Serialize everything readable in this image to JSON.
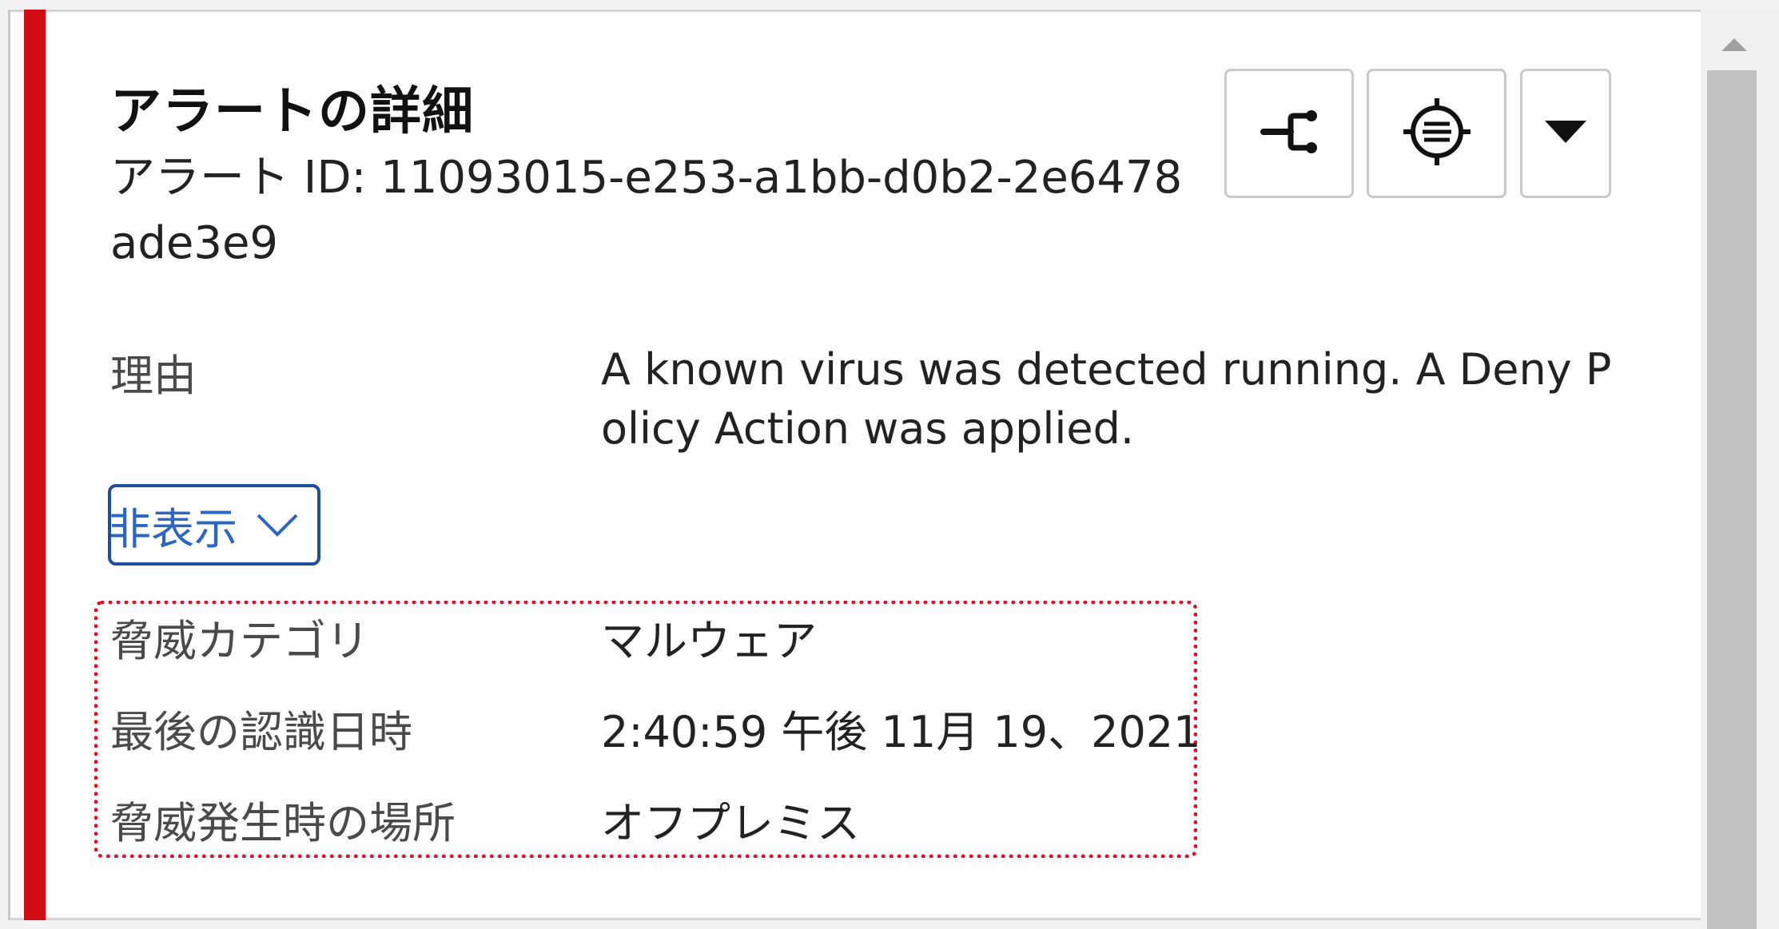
{
  "colors": {
    "severity": "#d10c14",
    "link": "#2b66c4",
    "highlight": "#e0102a"
  },
  "header": {
    "title": "アラートの詳細",
    "alert_id": "アラート ID: 11093015-e253-a1bb-d0b2-2e6478ade3e9"
  },
  "toolbar": {
    "share_icon": "share-graph-icon",
    "target_icon": "target-list-icon",
    "menu_icon": "caret-down-icon"
  },
  "details": {
    "reason_label": "理由",
    "reason_value": "A known virus was detected running. A Deny Policy Action was applied.",
    "toggle_label": "非表示",
    "category_label": "脅威カテゴリ",
    "category_value": "マルウェア",
    "last_seen_label": "最後の認識日時",
    "last_seen_value": "2:40:59 午後 11月 19、2021",
    "location_label": "脅威発生時の場所",
    "location_value": "オフプレミス"
  }
}
